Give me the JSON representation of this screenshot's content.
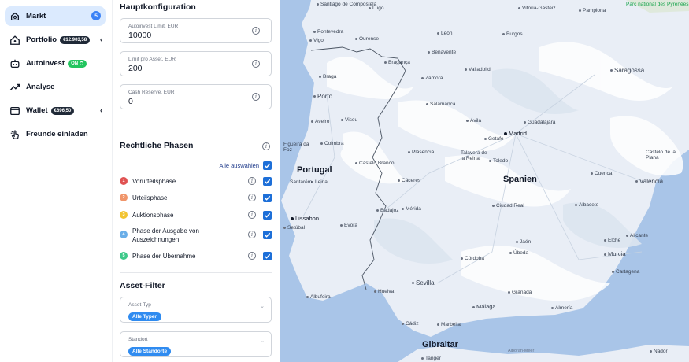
{
  "nav": {
    "items": [
      {
        "label": "Markt",
        "badge": "5"
      },
      {
        "label": "Portfolio",
        "amount": "€12.903,58"
      },
      {
        "label": "Autoinvest",
        "status": "ON"
      },
      {
        "label": "Analyse"
      },
      {
        "label": "Wallet",
        "amount": "€696,50"
      },
      {
        "label": "Freunde einladen"
      }
    ]
  },
  "config": {
    "title": "Hauptkonfiguration",
    "fields": [
      {
        "label": "Autoinvest Limit, EUR",
        "value": "10000"
      },
      {
        "label": "Limit pro Asset, EUR",
        "value": "200"
      },
      {
        "label": "Cash Reserve, EUR",
        "value": "0"
      }
    ]
  },
  "phases": {
    "title": "Rechtliche Phasen",
    "select_all": "Alle auswählen",
    "items": [
      {
        "num": "1",
        "label": "Vorurteilsphase",
        "color": "#e05252"
      },
      {
        "num": "2",
        "label": "Urteilsphase",
        "color": "#f0956a"
      },
      {
        "num": "3",
        "label": "Auktionsphase",
        "color": "#f2c431"
      },
      {
        "num": "4",
        "label": "Phase der Ausgabe von Auszeichnungen",
        "color": "#6aaee8"
      },
      {
        "num": "5",
        "label": "Phase der Übernahme",
        "color": "#3ec98a"
      }
    ]
  },
  "filters": {
    "title": "Asset-Filter",
    "asset_type": {
      "label": "Asset-Typ",
      "value": "Alle Typen"
    },
    "location": {
      "label": "Standort",
      "value": "Alle Standorte"
    }
  },
  "map": {
    "countries": [
      "Portugal",
      "Spanien"
    ],
    "cities": [
      "Madrid",
      "Lissabon",
      "Gibraltar"
    ],
    "places": [
      "Santiago de Compostela",
      "Lugo",
      "Vitoria-Gasteiz",
      "Pamplona",
      "Parc national des Pyrénées",
      "Pontevedra",
      "Ourense",
      "Burgos",
      "Vigo",
      "León",
      "Benavente",
      "Braga",
      "Bragança",
      "Valladolid",
      "Saragossa",
      "Porto",
      "Zamora",
      "Salamanca",
      "Aveiro",
      "Viseu",
      "Ávila",
      "Guadalajara",
      "Coimbra",
      "Getafe",
      "Figueira da Foz",
      "Plasencia",
      "Talavera de la Reina",
      "Toledo",
      "Castelo de la Plana",
      "Castelo Branco",
      "Leiria",
      "Santarém",
      "Cáceres",
      "Cuenca",
      "Valencia",
      "Badajoz",
      "Mérida",
      "Ciudad Real",
      "Albacete",
      "Setúbal",
      "Évora",
      "Elche",
      "Alicante",
      "Jaén",
      "Úbeda",
      "Murcia",
      "Córdoba",
      "Cartagena",
      "Sevilla",
      "Granada",
      "Albufeira",
      "Huelva",
      "Almería",
      "Málaga",
      "Marbella",
      "Cádiz",
      "Tanger",
      "Nador",
      "Alborán-Meer"
    ]
  },
  "colors": {
    "accent": "#1d6fd8",
    "active_nav": "#dbeafe",
    "sea": "#a9c5e8",
    "land": "#e8eef7"
  }
}
